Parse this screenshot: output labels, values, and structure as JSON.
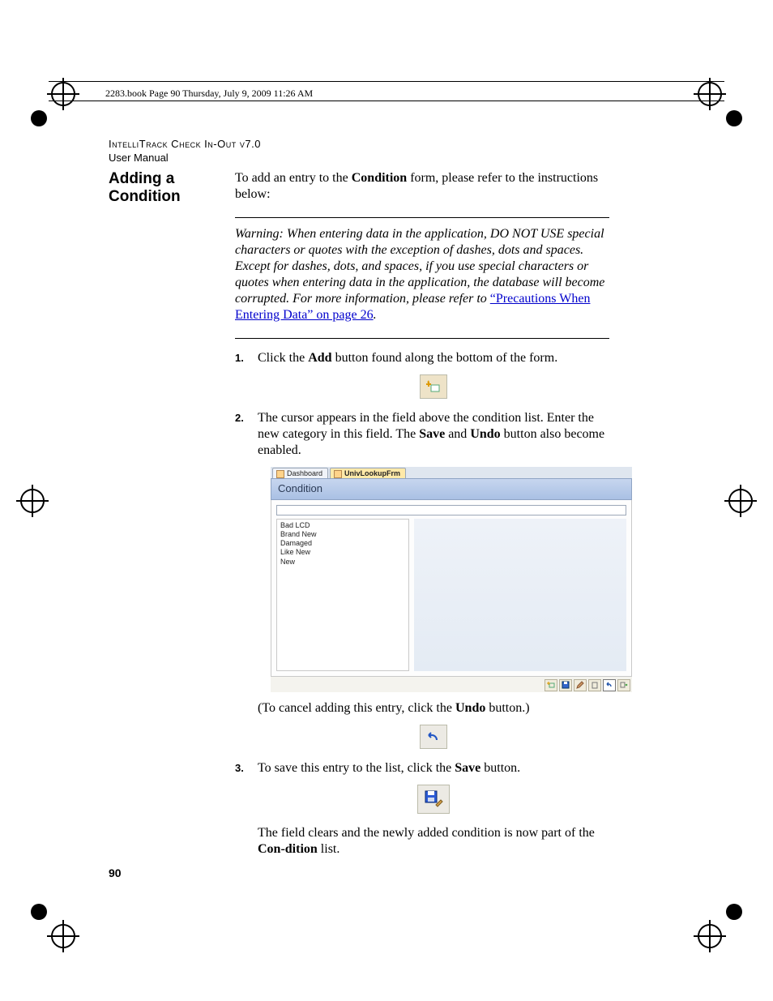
{
  "bookinfo": "2283.book  Page 90  Thursday, July 9, 2009  11:26 AM",
  "running_header": {
    "product": "IntelliTrack Check In-Out v7.0",
    "subtitle": "User Manual"
  },
  "section_title_line1": "Adding a",
  "section_title_line2": "Condition",
  "intro": {
    "pre": "To add an entry to the ",
    "bold": "Condition",
    "post": " form, please refer to the instructions below:"
  },
  "warning": {
    "lead": "Warning:   When entering data in the application, DO NOT USE special characters or quotes with the exception of dashes, dots and spaces. Except for dashes, dots, and spaces, if you use special characters or quotes when entering data in the application, the database will become corrupted. For more information, please refer to ",
    "link": "“Precautions When Entering Data” on page 26",
    "tail": "."
  },
  "steps": {
    "s1": {
      "pre": "Click the ",
      "b": "Add",
      "post": " button found along the bottom of the form."
    },
    "s2": {
      "p1_pre": "The cursor appears in the field above the condition list. Enter the new category in this field. The ",
      "p1_b1": "Save",
      "p1_mid": " and ",
      "p1_b2": "Undo",
      "p1_post": " button also become enabled.",
      "cancel_pre": "(To cancel adding this entry, click the ",
      "cancel_b": "Undo",
      "cancel_post": " button.)"
    },
    "s3": {
      "pre": "To save this entry to the list, click the ",
      "b": "Save",
      "post": " button.",
      "after_pre": "The field clears and the newly added condition is now part of the ",
      "after_b": "Con-dition",
      "after_post": " list."
    }
  },
  "appshot": {
    "tabs": {
      "dashboard": "Dashboard",
      "lookup": "UnivLookupFrm"
    },
    "title": "Condition",
    "items": [
      "Bad LCD",
      "Brand New",
      "Damaged",
      "Like New",
      "New"
    ],
    "toolbar": {
      "add": "add",
      "save": "save",
      "edit": "edit",
      "delete": "delete",
      "undo": "undo",
      "close": "close"
    }
  },
  "page_number": "90"
}
